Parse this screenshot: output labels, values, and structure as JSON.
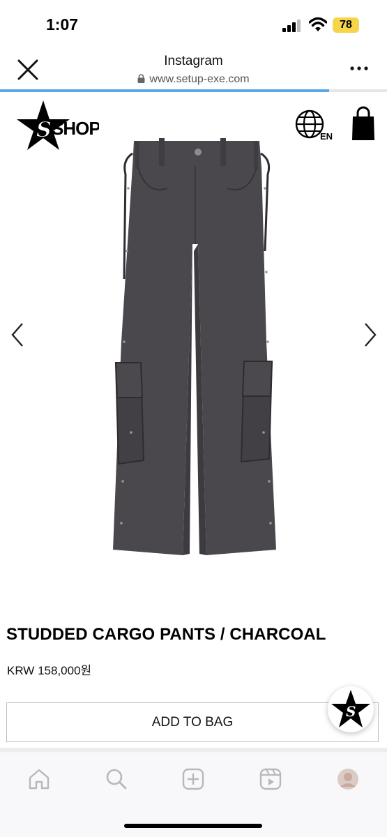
{
  "status_bar": {
    "time": "1:07",
    "battery": "78",
    "battery_color": "#f6d54a"
  },
  "browser": {
    "title": "Instagram",
    "url": "www.setup-exe.com",
    "load_progress_percent": 85,
    "progress_color": "#5aa9e6"
  },
  "site_header": {
    "logo_text": "SHOP",
    "language_code": "EN",
    "icons": [
      "star-logo",
      "globe-icon",
      "shopping-bag-icon"
    ]
  },
  "product": {
    "title": "STUDDED CARGO PANTS / CHARCOAL",
    "price": "KRW 158,000원",
    "add_to_bag_label": "ADD TO BAG",
    "image_color": "#4a474d"
  },
  "carousel": {
    "icons": [
      "chevron-left-icon",
      "chevron-right-icon"
    ]
  },
  "bottom_nav": {
    "items": [
      "home-icon",
      "search-icon",
      "create-icon",
      "reels-icon",
      "profile-avatar"
    ]
  }
}
